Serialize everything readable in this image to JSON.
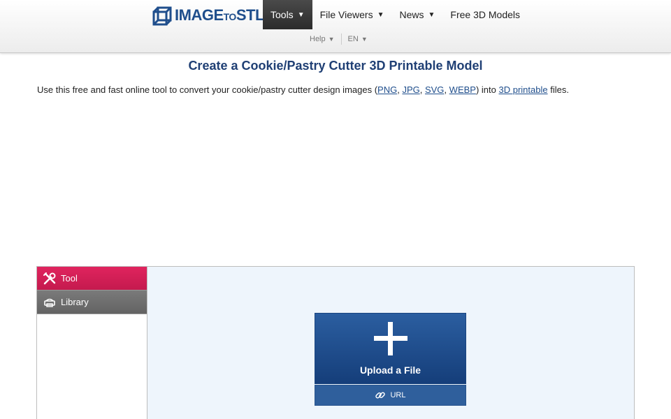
{
  "header": {
    "logo": {
      "main": "IMAGE",
      "small": "TO",
      "end": "STL",
      "brand_color": "#1f4e8c"
    },
    "nav": [
      {
        "label": "Tools",
        "caret": "▼",
        "active": true
      },
      {
        "label": "File Viewers",
        "caret": "▼"
      },
      {
        "label": "News",
        "caret": "▼"
      },
      {
        "label": "Free 3D Models"
      }
    ],
    "subnav": [
      {
        "label": "Help",
        "caret": "▼"
      },
      {
        "label": "EN",
        "caret": "▼"
      }
    ]
  },
  "main": {
    "title": "Create a Cookie/Pastry Cutter 3D Printable Model",
    "intro": {
      "before": "Use this free and fast online tool to convert your cookie/pastry cutter design images (",
      "links": [
        "PNG",
        "JPG",
        "SVG",
        "WEBP"
      ],
      "middle": ") into ",
      "printable_link": "3D printable",
      "after": " files."
    }
  },
  "panel": {
    "tabs": [
      {
        "label": "Tool",
        "icon": "tools-icon",
        "color": "#d81f57"
      },
      {
        "label": "Library",
        "icon": "printer-icon",
        "color": "#6e6e6e"
      }
    ],
    "upload": {
      "label": "Upload a File",
      "icon": "plus-icon"
    },
    "url": {
      "label": "URL",
      "icon": "link-icon"
    }
  }
}
